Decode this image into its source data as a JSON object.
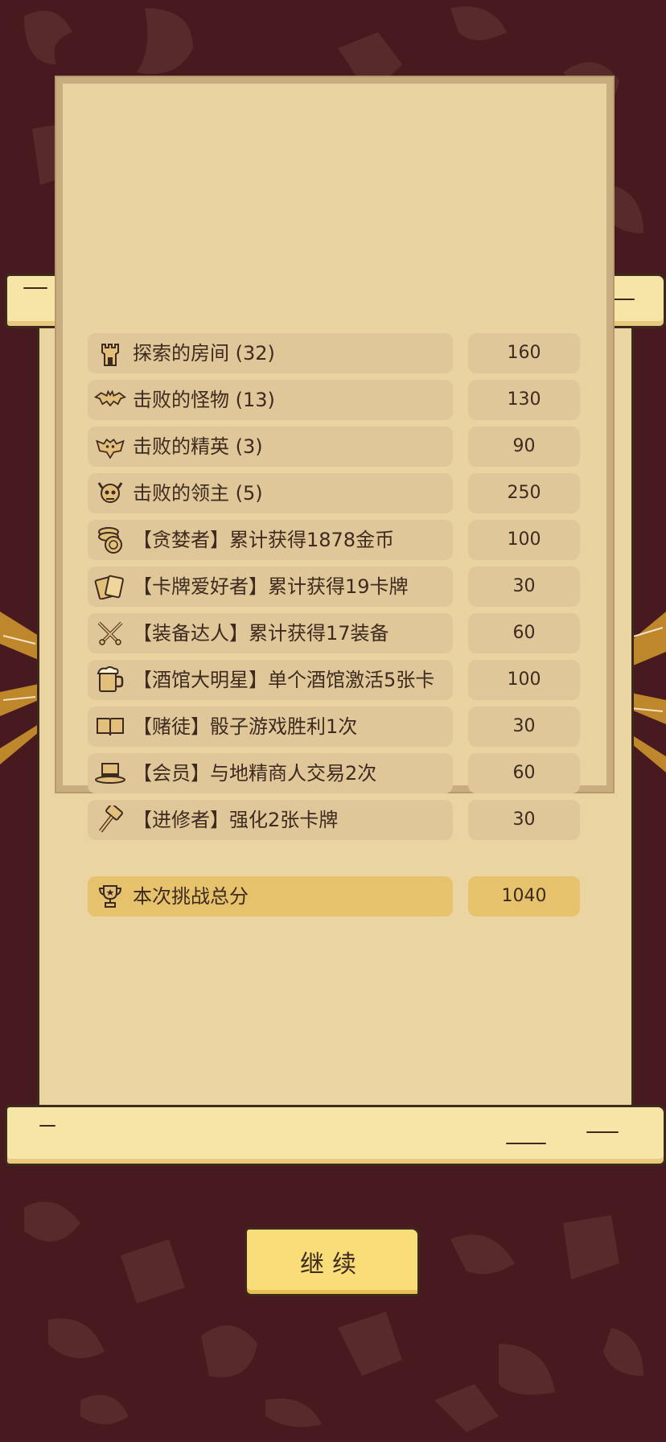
{
  "colors": {
    "background": "#461a1e",
    "pattern": "#5a2b2e",
    "parchment": "#ead4a2",
    "pill": "#dfc79a",
    "total_pill": "#e7c26c",
    "button": "#f9dd79",
    "text": "#3e2b1f"
  },
  "score_rows": [
    {
      "icon": "tower-icon",
      "label": "探索的房间 (32)",
      "value": "160"
    },
    {
      "icon": "bat-icon",
      "label": "击败的怪物 (13)",
      "value": "130"
    },
    {
      "icon": "demon-bat-icon",
      "label": "击败的精英 (3)",
      "value": "90"
    },
    {
      "icon": "horned-skull-icon",
      "label": "击败的领主 (5)",
      "value": "250"
    },
    {
      "icon": "coins-icon",
      "label": "【贪婪者】累计获得1878金币",
      "value": "100"
    },
    {
      "icon": "cards-icon",
      "label": "【卡牌爱好者】累计获得19卡牌",
      "value": "30"
    },
    {
      "icon": "crossed-swords-icon",
      "label": "【装备达人】累计获得17装备",
      "value": "60"
    },
    {
      "icon": "beer-mug-icon",
      "label": "【酒馆大明星】单个酒馆激活5张卡",
      "value": "100"
    },
    {
      "icon": "open-book-icon",
      "label": "【赌徒】骰子游戏胜利1次",
      "value": "30"
    },
    {
      "icon": "top-hat-icon",
      "label": "【会员】与地精商人交易2次",
      "value": "60"
    },
    {
      "icon": "hammer-icon",
      "label": "【进修者】强化2张卡牌",
      "value": "30"
    }
  ],
  "total": {
    "icon": "trophy-icon",
    "label": "本次挑战总分",
    "value": "1040"
  },
  "continue_button": {
    "label": "继续"
  }
}
